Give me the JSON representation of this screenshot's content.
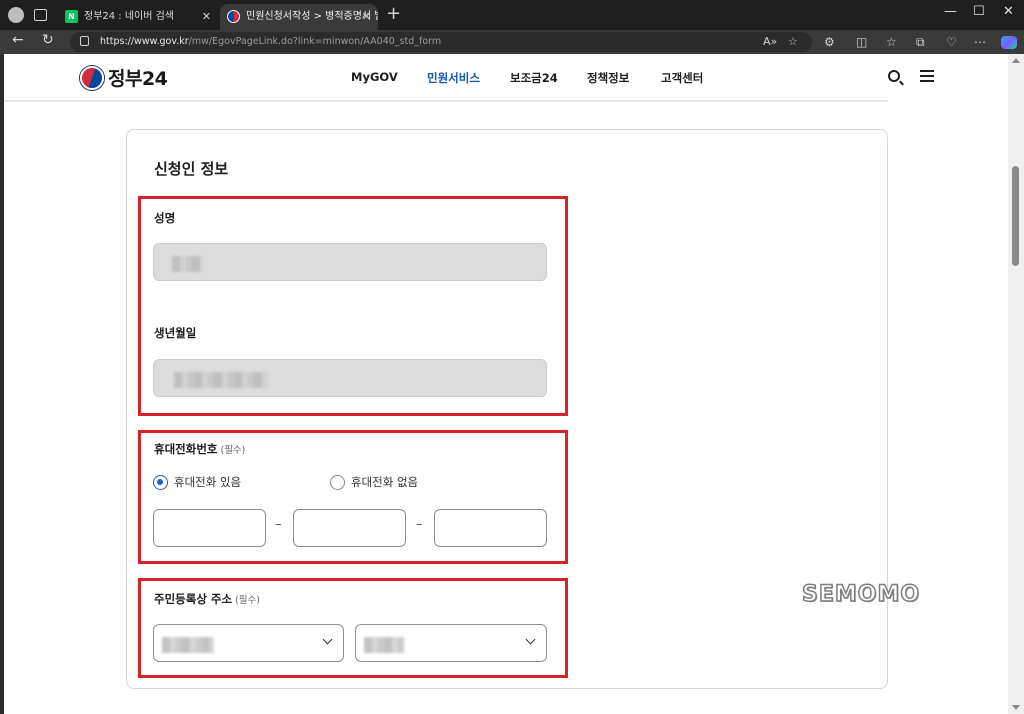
{
  "browser": {
    "tabs": [
      {
        "title": "정부24 : 네이버 검색",
        "favicon": "naver-icon"
      },
      {
        "title": "민원신청서작성 > 병적증명서 발급",
        "favicon": "gov24-icon"
      }
    ],
    "new_tab": "+",
    "close": "✕",
    "window": {
      "minimize": "—",
      "maximize": "☐",
      "close": "✕"
    },
    "url_host": "https://www.gov.kr",
    "url_path": "/mw/EgovPageLink.do?link=minwon/AA040_std_form",
    "reader_mode": "A»"
  },
  "site": {
    "logo_text": "정부24",
    "nav": [
      "MyGOV",
      "민원서비스",
      "보조금24",
      "정책정보",
      "고객센터"
    ],
    "active_nav": "민원서비스"
  },
  "form": {
    "section_title": "신청인 정보",
    "name_label": "성명",
    "birth_label": "생년월일",
    "phone_label": "휴대전화번호",
    "required_tag": "(필수)",
    "radio_has_phone": "휴대전화 있음",
    "radio_no_phone": "휴대전화 없음",
    "selected_radio": "휴대전화 있음",
    "phone_separator": "–",
    "address_label": "주민등록상 주소"
  },
  "watermark": "SEMOMO",
  "colors": {
    "accent": "#1357b3",
    "highlight_box": "#d8222a",
    "readonly_bg": "#dcdcdc"
  }
}
